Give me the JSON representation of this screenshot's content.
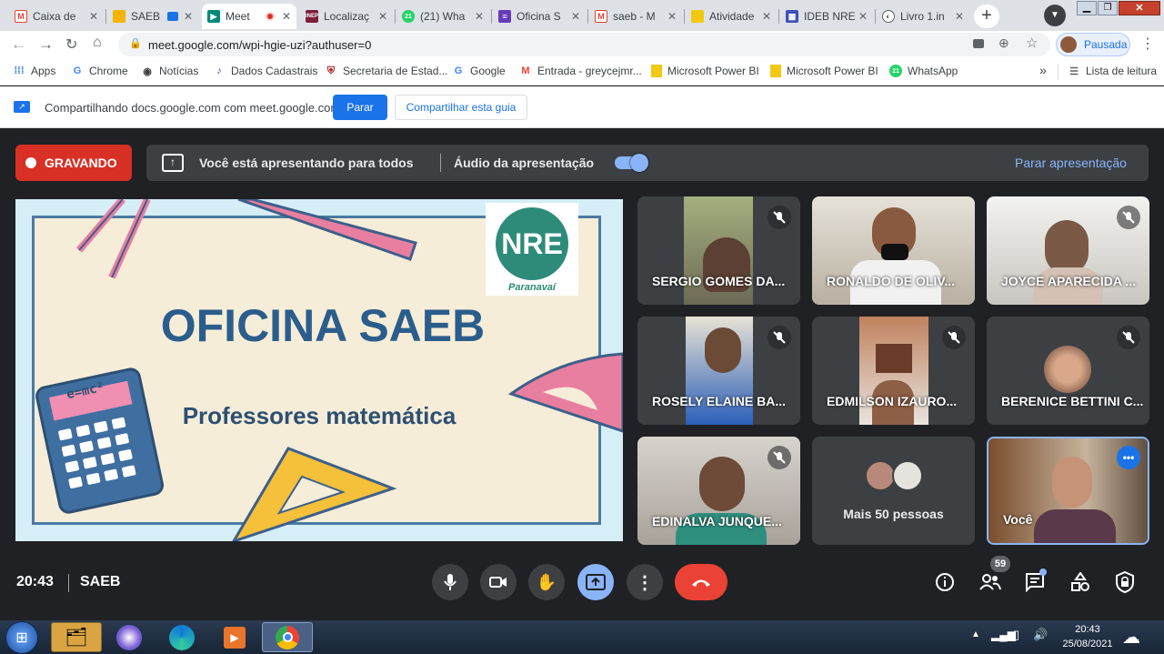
{
  "browser": {
    "tabs": [
      {
        "label": "Caixa de",
        "icon": "gmail-icon",
        "color": "#ea4335"
      },
      {
        "label": "SAEB",
        "icon": "slides-icon",
        "color": "#f4b400"
      },
      {
        "label": "Meet",
        "icon": "meet-icon",
        "color": "#00897b"
      },
      {
        "label": "Localizaç",
        "icon": "inep-icon",
        "color": "#7b1e3a"
      },
      {
        "label": "(21) Wha",
        "icon": "whatsapp-icon",
        "color": "#25d366"
      },
      {
        "label": "Oficina S",
        "icon": "forms-icon",
        "color": "#673ab7"
      },
      {
        "label": "saeb - M",
        "icon": "gmail-icon",
        "color": "#ea4335"
      },
      {
        "label": "Atividade",
        "icon": "powerbi-icon",
        "color": "#f2c811"
      },
      {
        "label": "IDEB NRE",
        "icon": "docs-icon",
        "color": "#3f51b5"
      },
      {
        "label": "Livro 1.in",
        "icon": "globe-icon",
        "color": "#5f6368"
      }
    ],
    "url": "meet.google.com/wpi-hgie-uzi?authuser=0",
    "profile_label": "Pausada",
    "new_tab_symbol": "+"
  },
  "bookmarks": [
    {
      "label": "Apps",
      "icon": "apps-icon"
    },
    {
      "label": "Chrome",
      "icon": "google-icon"
    },
    {
      "label": "Notícias",
      "icon": "news-icon"
    },
    {
      "label": "Dados Cadastrais",
      "icon": "data-icon"
    },
    {
      "label": "Secretaria de Estad...",
      "icon": "crest-icon"
    },
    {
      "label": "Google",
      "icon": "google-icon"
    },
    {
      "label": "Entrada - greycejmr...",
      "icon": "gmail-icon"
    },
    {
      "label": "Microsoft Power BI",
      "icon": "powerbi-icon"
    },
    {
      "label": "Microsoft Power BI",
      "icon": "powerbi-icon"
    },
    {
      "label": "WhatsApp",
      "icon": "whatsapp-icon"
    }
  ],
  "bookmarks_more": "»",
  "reading_list": "Lista de leitura",
  "sharing": {
    "message": "Compartilhando docs.google.com com meet.google.com",
    "stop_label": "Parar",
    "share_tab_label": "Compartilhar esta guia"
  },
  "meet": {
    "recording_label": "GRAVANDO",
    "presenting_label": "Você está apresentando para todos",
    "audio_label": "Áudio da apresentação",
    "audio_enabled": true,
    "stop_presenting_label": "Parar apresentação",
    "slide": {
      "title": "OFICINA SAEB",
      "subtitle": "Professores matemática",
      "logo_text": "NRE",
      "logo_sub": "Paranavaí",
      "calculator_text": "e=mc²"
    },
    "participants": [
      {
        "name": "SERGIO GOMES DA...",
        "muted": true
      },
      {
        "name": "RONALDO DE OLIV...",
        "muted": false
      },
      {
        "name": "JOYCE APARECIDA ...",
        "muted": true
      },
      {
        "name": "ROSELY ELAINE BA...",
        "muted": true
      },
      {
        "name": "EDMILSON IZAURO...",
        "muted": true
      },
      {
        "name": "BERENICE BETTINI C...",
        "muted": true
      },
      {
        "name": "EDINALVA JUNQUE...",
        "muted": true
      },
      {
        "name": "Mais 50 pessoas",
        "muted": false
      },
      {
        "name": "Você",
        "muted": false
      }
    ],
    "time": "20:43",
    "meeting_name": "SAEB",
    "participant_count": "59"
  },
  "taskbar": {
    "time": "20:43",
    "date": "25/08/2021"
  },
  "colors": {
    "accent": "#8ab4f8",
    "record_red": "#d93025",
    "end_call": "#ea4335",
    "slide_title": "#2b5d8c"
  }
}
